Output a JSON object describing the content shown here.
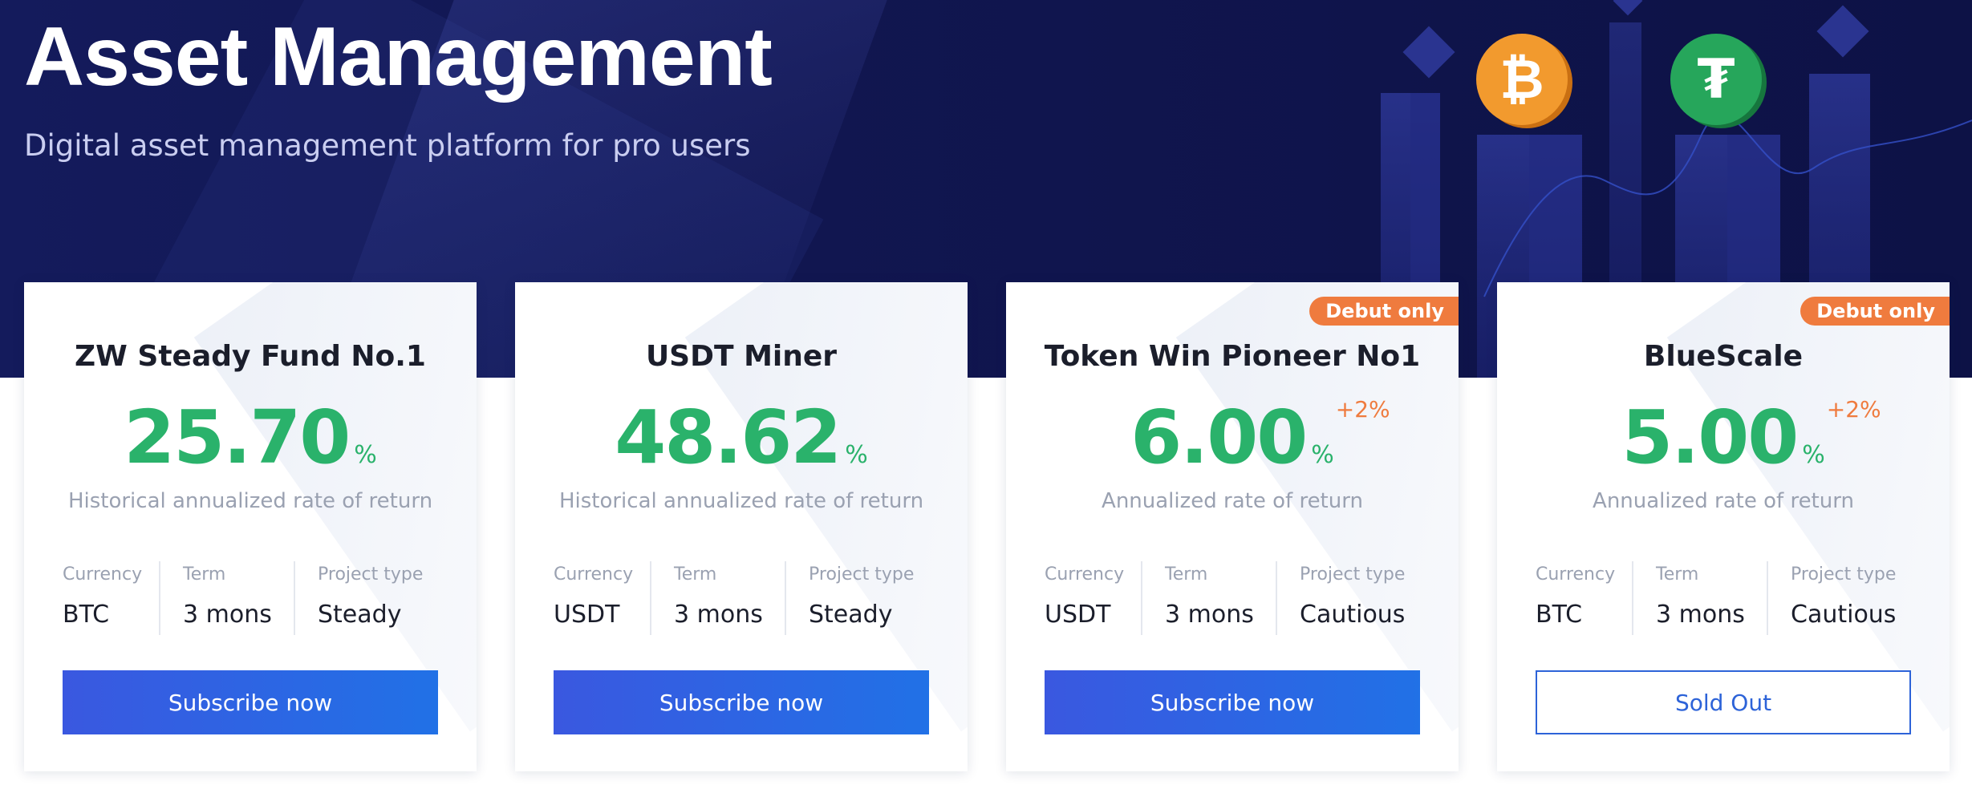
{
  "hero": {
    "title": "Asset Management",
    "subtitle": "Digital asset management platform for pro users",
    "coins": [
      {
        "icon": "bitcoin-icon",
        "glyph": "₿",
        "color": "#f29a2e"
      },
      {
        "icon": "tether-icon",
        "glyph": "₮",
        "color": "#26a65b"
      }
    ]
  },
  "labels": {
    "currency": "Currency",
    "term": "Term",
    "project_type": "Project type",
    "rate_unit": "%"
  },
  "colors": {
    "hero_background": "#111650",
    "rate_green": "#2ab26b",
    "badge_orange": "#ef7b3e",
    "button_blue": "#2d63d8"
  },
  "cards": [
    {
      "title": "ZW Steady Fund No.1",
      "rate": "25.70",
      "bonus": "",
      "rate_label": "Historical annualized rate of return",
      "badge": "",
      "currency": "BTC",
      "term": "3 mons",
      "project_type": "Steady",
      "button": "Subscribe now"
    },
    {
      "title": "USDT Miner",
      "rate": "48.62",
      "bonus": "",
      "rate_label": "Historical annualized rate of return",
      "badge": "",
      "currency": "USDT",
      "term": "3 mons",
      "project_type": "Steady",
      "button": "Subscribe now"
    },
    {
      "title": "Token Win Pioneer No1",
      "rate": "6.00",
      "bonus": "+2%",
      "rate_label": "Annualized rate of return",
      "badge": "Debut only",
      "currency": "USDT",
      "term": "3 mons",
      "project_type": "Cautious",
      "button": "Subscribe now"
    },
    {
      "title": "BlueScale",
      "rate": "5.00",
      "bonus": "+2%",
      "rate_label": "Annualized rate of return",
      "badge": "Debut only",
      "currency": "BTC",
      "term": "3 mons",
      "project_type": "Cautious",
      "button": "Sold Out"
    }
  ]
}
